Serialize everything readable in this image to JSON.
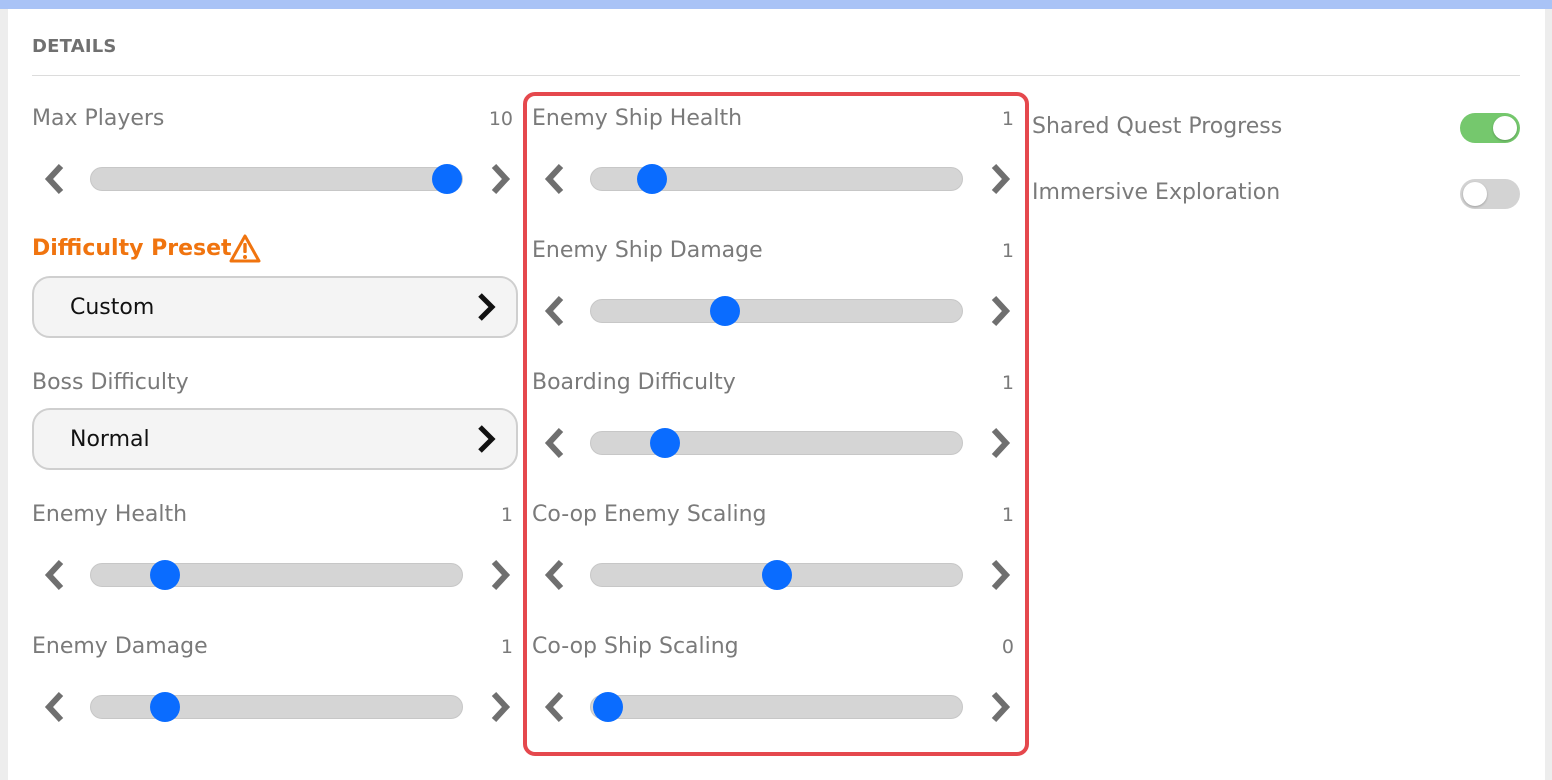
{
  "section": {
    "heading": "DETAILS"
  },
  "left": {
    "max_players": {
      "label": "Max Players",
      "value": "10",
      "level": 0.96
    },
    "difficulty_preset": {
      "label": "Difficulty Preset",
      "selected": "Custom",
      "warning_icon": "warning-triangle-icon",
      "accent": "#f0740f"
    },
    "boss_difficulty": {
      "label": "Boss Difficulty",
      "selected": "Normal"
    },
    "enemy_health": {
      "label": "Enemy Health",
      "value": "1",
      "level": 0.2
    },
    "enemy_damage": {
      "label": "Enemy Damage",
      "value": "1",
      "level": 0.2
    }
  },
  "middle": {
    "enemy_ship_health": {
      "label": "Enemy Ship Health",
      "value": "1",
      "level": 0.165
    },
    "enemy_ship_damage": {
      "label": "Enemy Ship Damage",
      "value": "1",
      "level": 0.36
    },
    "boarding_difficulty": {
      "label": "Boarding Difficulty",
      "value": "1",
      "level": 0.2
    },
    "coop_enemy_scaling": {
      "label": "Co-op Enemy Scaling",
      "value": "1",
      "level": 0.5
    },
    "coop_ship_scaling": {
      "label": "Co-op Ship Scaling",
      "value": "0",
      "level": 0.045
    }
  },
  "right": {
    "shared_quest_progress": {
      "label": "Shared Quest Progress",
      "enabled": true
    },
    "immersive_exploration": {
      "label": "Immersive Exploration",
      "enabled": false
    }
  },
  "colors": {
    "slider_thumb": "#0a6cff",
    "toggle_on": "#75c86d",
    "highlight_border": "#e5484d"
  },
  "icons": {
    "decrease": "chevron-left-icon",
    "increase": "chevron-right-icon",
    "open_selector": "chevron-right-icon"
  }
}
